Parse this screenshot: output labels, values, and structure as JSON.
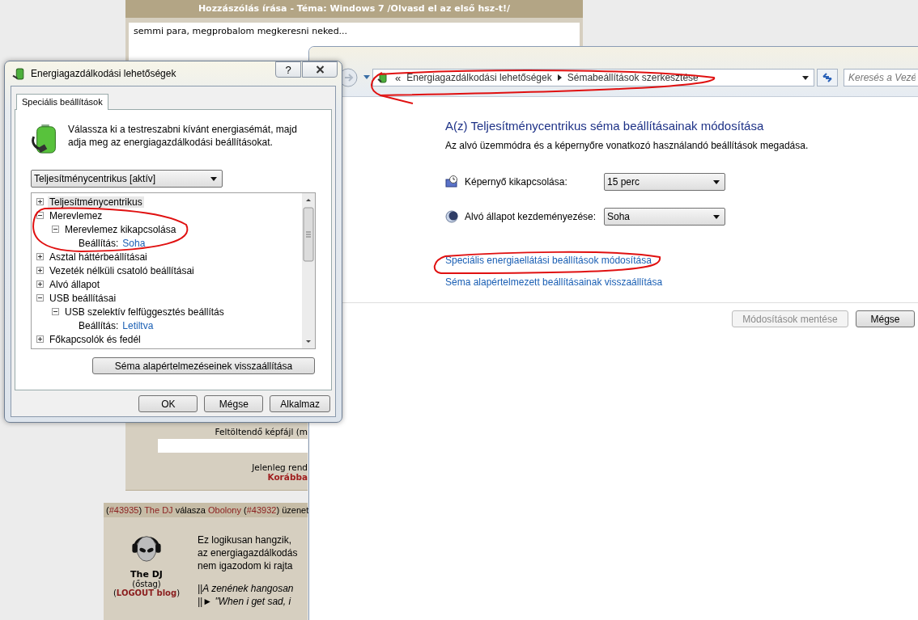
{
  "forum": {
    "title": "Hozzászólás írása - Téma: Windows 7 /Olvasd el az első hsz-t!/",
    "message": "semmi para, megprobalom megkeresni neked...",
    "upload_label": "Feltöltendő képfájl (m",
    "status_text": "Jelenleg rend",
    "older_link": "Korábba"
  },
  "post": {
    "header": [
      {
        "kind": "plain",
        "text": "("
      },
      {
        "kind": "link",
        "text": "#43935"
      },
      {
        "kind": "plain",
        "text": ") "
      },
      {
        "kind": "link",
        "text": "The DJ"
      },
      {
        "kind": "plain",
        "text": " válasza "
      },
      {
        "kind": "link",
        "text": "Obolony"
      },
      {
        "kind": "plain",
        "text": " ("
      },
      {
        "kind": "link",
        "text": "#43932"
      },
      {
        "kind": "plain",
        "text": ") üzenet"
      }
    ],
    "author": {
      "name": "The DJ",
      "rank": "(őstag)",
      "blog_open": "(",
      "blog_link": "LOGOUT blog",
      "blog_close": ")"
    },
    "body": [
      "Ez logikusan hangzik,",
      "az energiagazdálkodás",
      "nem igazodom ki rajta"
    ],
    "signature": [
      "||A zenének hangosan",
      "||► \"When i get sad, i"
    ]
  },
  "control_panel": {
    "overflow": "«",
    "breadcrumb": [
      "Energiagazdálkodási lehetőségek",
      "Sémabeállítások szerkesztése"
    ],
    "search": {
      "placeholder": "Keresés a Vezé"
    },
    "heading": "A(z) Teljesítménycentrikus séma beállításainak módosítása",
    "subtitle": "Az alvó üzemmódra és a képernyőre vonatkozó használandó beállítások megadása.",
    "settings": [
      {
        "kind": "display",
        "label": "Képernyő kikapcsolása:",
        "value": "15 perc"
      },
      {
        "kind": "sleep",
        "label": "Alvó állapot kezdeményezése:",
        "value": "Soha"
      }
    ],
    "links": [
      "Speciális energiaellátási beállítások módosítása",
      "Séma alapértelmezett beállításainak visszaállítása"
    ],
    "buttons": [
      {
        "label": "Módosítások mentése",
        "disabled": true
      },
      {
        "label": "Mégse",
        "disabled": false
      }
    ]
  },
  "dialog": {
    "title": "Energiagazdálkodási lehetőségek",
    "help": "?",
    "tabs": [
      {
        "label": "Speciális beállítások",
        "selected": true
      }
    ],
    "description": "Válassza ki a testreszabni kívánt energiasémát, majd adja meg az energiagazdálkodási beállításokat.",
    "plan": "Teljesítménycentrikus [aktív]",
    "tree": [
      {
        "kind": "group",
        "label": "Teljesítménycentrikus",
        "expanded": false,
        "selected": true
      },
      {
        "kind": "group",
        "label": "Merevlemez",
        "expanded": true,
        "selected": false,
        "children": [
          {
            "kind": "group",
            "label": "Merevlemez kikapcsolása",
            "expanded": true,
            "selected": false,
            "children": [
              {
                "kind": "setting",
                "label": "Beállítás:",
                "value": "Soha"
              }
            ]
          }
        ]
      },
      {
        "kind": "group",
        "label": "Asztal háttérbeállításai",
        "expanded": false,
        "selected": false
      },
      {
        "kind": "group",
        "label": "Vezeték nélküli csatoló beállításai",
        "expanded": false,
        "selected": false
      },
      {
        "kind": "group",
        "label": "Alvó állapot",
        "expanded": false,
        "selected": false
      },
      {
        "kind": "group",
        "label": "USB beállításai",
        "expanded": true,
        "selected": false,
        "children": [
          {
            "kind": "group",
            "label": "USB szelektív felfüggesztés beállítás",
            "expanded": true,
            "selected": false,
            "children": [
              {
                "kind": "setting",
                "label": "Beállítás:",
                "value": "Letiltva"
              }
            ]
          }
        ]
      },
      {
        "kind": "group",
        "label": "Főkapcsolók és fedél",
        "expanded": false,
        "selected": false
      }
    ],
    "reset_button": "Séma alapértelmezéseinek visszaállítása",
    "buttons": [
      "OK",
      "Mégse",
      "Alkalmaz"
    ]
  }
}
